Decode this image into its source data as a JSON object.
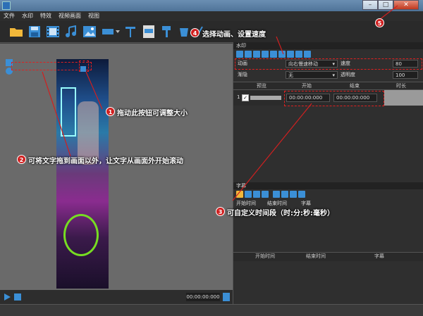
{
  "menu": [
    "文件",
    "水印",
    "特效",
    "视频画面",
    "视图"
  ],
  "window_controls": {
    "minimize": "–",
    "maximize": "□",
    "close": "✕"
  },
  "toolbar_icons": [
    "open-folder-icon",
    "save-icon",
    "film-icon",
    "music-icon",
    "image-icon",
    "shape-icon",
    "text-icon",
    "subtitle-file-icon",
    "brush-icon",
    "bucket-icon",
    "line-icon"
  ],
  "watermark_panel": {
    "title": "水印",
    "anim_label": "动画",
    "anim_value": "向右慢速移动",
    "speed_label": "速度",
    "speed_value": "80",
    "fade_label": "渐隐",
    "fade_value": "无",
    "opacity_label": "透明度",
    "opacity_value": "100",
    "col_preview": "预览",
    "col_start": "开始",
    "col_end": "结束",
    "col_duration": "时长",
    "row_index": "1",
    "row_start": "00:00:00:000",
    "row_end": "00:00:00:000"
  },
  "subtitle_panel": {
    "title": "字幕",
    "start_time": "开始时间",
    "end_time": "结束时间",
    "subtitle": "字幕"
  },
  "subtitle_list_header": {
    "start": "开始时间",
    "end": "结束时间",
    "subtitle": "字幕"
  },
  "player": {
    "time": "00:00:00:000"
  },
  "annotations": {
    "n1": "1",
    "t1": "拖动此按钮可调整大小",
    "n2": "2",
    "t2": "可将文字拖到画面以外，让文字从画面外开始滚动",
    "n3": "3",
    "t3": "可自定义时间段（时:分:秒:毫秒）",
    "n4": "4",
    "t4": "选择动画、设置速度",
    "n5": "5"
  },
  "colors": {
    "accent_red": "#d02020",
    "dark_bg": "#2f2f2f",
    "preview_bg": "#6a6a6a"
  }
}
